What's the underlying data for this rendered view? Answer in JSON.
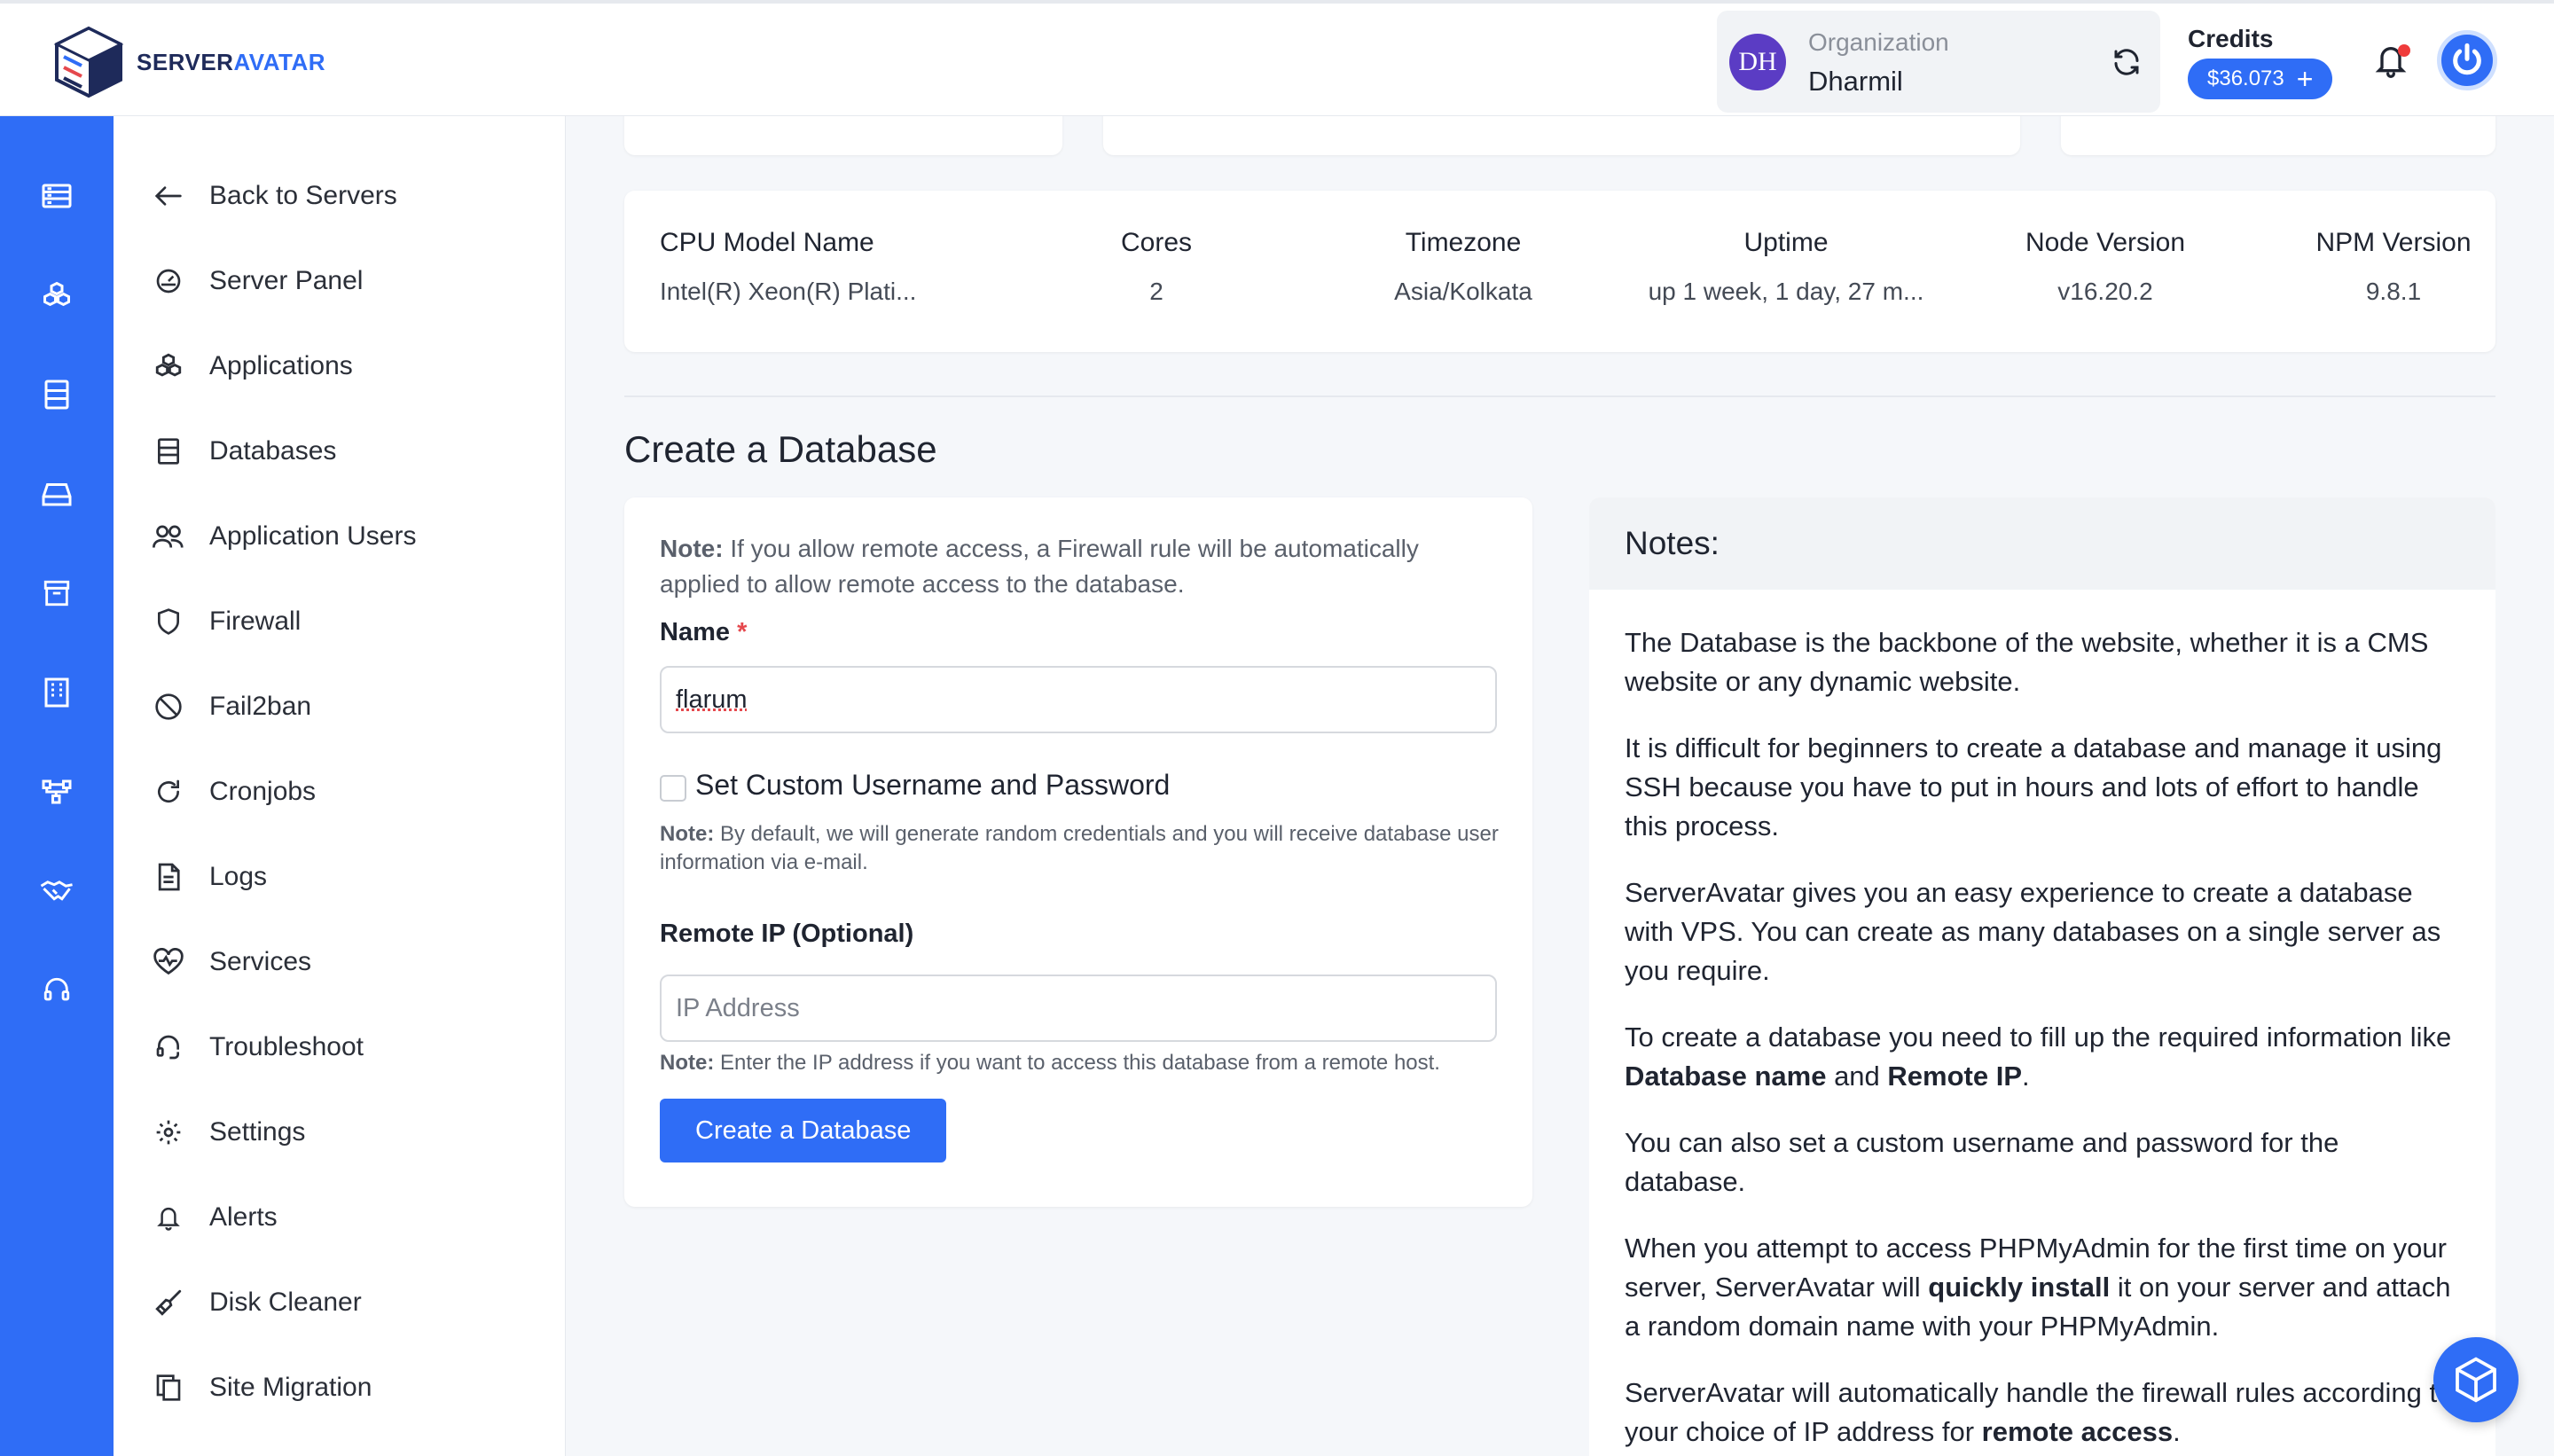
{
  "brand": {
    "name_part1": "SERVER",
    "name_part2": "AVATAR"
  },
  "header": {
    "org_initials": "DH",
    "org_label": "Organization",
    "org_name": "Dharmil",
    "credits_label": "Credits",
    "credits_value": "$36.073"
  },
  "rail_icons": [
    "servers-icon",
    "applications-icon",
    "databases-icon",
    "storage-icon",
    "archive-icon",
    "building-icon",
    "network-icon",
    "handshake-icon",
    "support-icon"
  ],
  "sidenav": {
    "items": [
      {
        "label": "Back to Servers",
        "icon": "arrow-left-icon"
      },
      {
        "label": "Server Panel",
        "icon": "gauge-icon"
      },
      {
        "label": "Applications",
        "icon": "cubes-icon"
      },
      {
        "label": "Databases",
        "icon": "database-icon"
      },
      {
        "label": "Application Users",
        "icon": "users-icon"
      },
      {
        "label": "Firewall",
        "icon": "shield-icon"
      },
      {
        "label": "Fail2ban",
        "icon": "ban-icon"
      },
      {
        "label": "Cronjobs",
        "icon": "refresh-icon"
      },
      {
        "label": "Logs",
        "icon": "document-icon"
      },
      {
        "label": "Services",
        "icon": "heartbeat-icon"
      },
      {
        "label": "Troubleshoot",
        "icon": "headset-icon"
      },
      {
        "label": "Settings",
        "icon": "gear-icon"
      },
      {
        "label": "Alerts",
        "icon": "bell-icon"
      },
      {
        "label": "Disk Cleaner",
        "icon": "broom-icon"
      },
      {
        "label": "Site Migration",
        "icon": "copy-icon"
      }
    ]
  },
  "server_info": {
    "headers": [
      "CPU Model Name",
      "Cores",
      "Timezone",
      "Uptime",
      "Node Version",
      "NPM Version"
    ],
    "values": [
      "Intel(R) Xeon(R) Plati...",
      "2",
      "Asia/Kolkata",
      "up 1 week, 1 day, 27 m...",
      "v16.20.2",
      "9.8.1"
    ]
  },
  "create_db": {
    "title": "Create a Database",
    "note_bold": "Note:",
    "note_text": " If you allow remote access, a Firewall rule will be automatically applied to allow remote access to the database.",
    "name_label": "Name",
    "required_mark": "*",
    "name_value": "flarum",
    "custom_checkbox_label": "Set Custom Username and Password",
    "custom_note_bold": "Note:",
    "custom_note_text": " By default, we will generate random credentials and you will receive database user information via e-mail.",
    "remote_ip_label": "Remote IP (Optional)",
    "remote_ip_placeholder": "IP Address",
    "remote_note_bold": "Note:",
    "remote_note_text": " Enter the IP address if you want to access this database from a remote host.",
    "submit_label": "Create a Database"
  },
  "notes": {
    "title": "Notes:",
    "p1": "The Database is the backbone of the website, whether it is a CMS website or any dynamic website.",
    "p2": "It is difficult for beginners to create a database and manage it using SSH because you have to put in hours and lots of effort to handle this process.",
    "p3": "ServerAvatar gives you an easy experience to create a database with VPS. You can create as many databases on a single server as you require.",
    "p4_a": "To create a database you need to fill up the required information like ",
    "p4_b": "Database name",
    "p4_c": " and ",
    "p4_d": "Remote IP",
    "p4_e": ".",
    "p5": "You can also set a custom username and password for the database.",
    "p6_a": "When you attempt to access PHPMyAdmin for the first time on your server, ServerAvatar will ",
    "p6_b": "quickly install",
    "p6_c": " it on your server and attach a random domain name with your PHPMyAdmin.",
    "p7_a": "ServerAvatar will automatically handle the firewall rules according to your choice of IP address for ",
    "p7_b": "remote access",
    "p7_c": "."
  },
  "colors": {
    "primary": "#2f6df6",
    "rail": "#2f6df6",
    "required": "#e5484d"
  }
}
